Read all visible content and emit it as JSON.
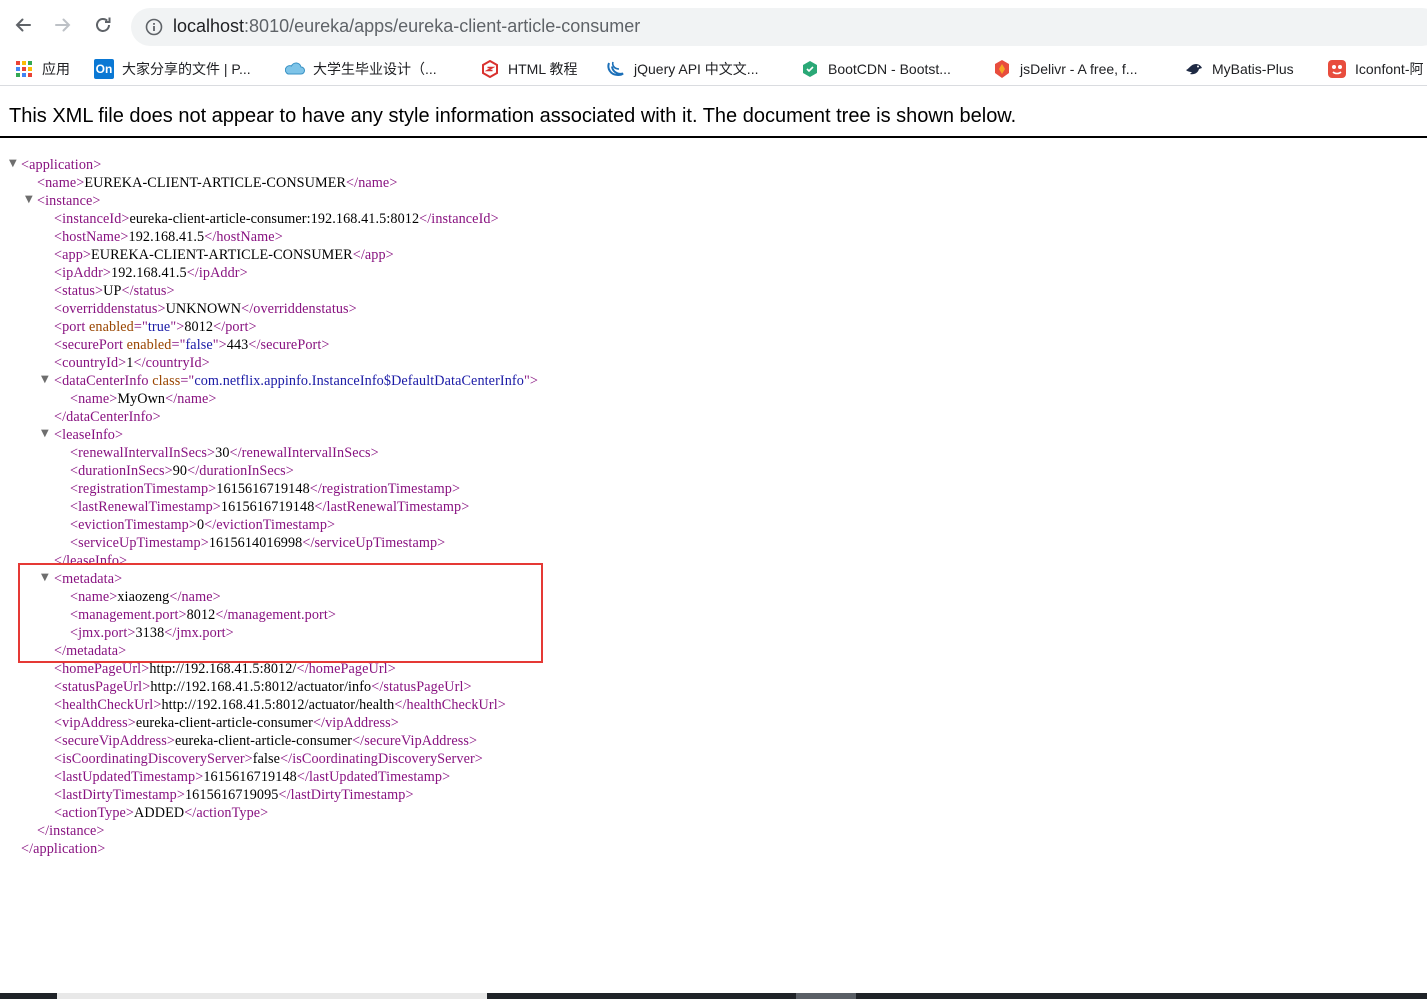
{
  "browser": {
    "url_host": "localhost",
    "url_path": ":8010/eureka/apps/eureka-client-article-consumer"
  },
  "bookmarks": [
    {
      "label": "应用",
      "icon": "apps-grid-icon"
    },
    {
      "label": "大家分享的文件 | P...",
      "icon": "onedrive-on-icon",
      "icon_text": "On"
    },
    {
      "label": "大学生毕业设计（...",
      "icon": "cloud-icon"
    },
    {
      "label": "HTML 教程",
      "icon": "runoob-icon"
    },
    {
      "label": "jQuery API 中文文...",
      "icon": "jquery-icon"
    },
    {
      "label": "BootCDN - Bootst...",
      "icon": "bootcdn-icon"
    },
    {
      "label": "jsDelivr - A free, f...",
      "icon": "jsdelivr-icon"
    },
    {
      "label": "MyBatis-Plus",
      "icon": "mybatis-bird-icon"
    },
    {
      "label": "Iconfont-阿",
      "icon": "iconfont-icon"
    }
  ],
  "page": {
    "notice": "This XML file does not appear to have any style information associated with it. The document tree is shown below."
  },
  "xml": {
    "application": "application",
    "name_tag": "name",
    "app_name": "EUREKA-CLIENT-ARTICLE-CONSUMER",
    "instance": "instance",
    "instanceId": "eureka-client-article-consumer:192.168.41.5:8012",
    "hostName": "192.168.41.5",
    "app": "EUREKA-CLIENT-ARTICLE-CONSUMER",
    "ipAddr": "192.168.41.5",
    "status": "UP",
    "overriddenstatus": "UNKNOWN",
    "port_enabled": "true",
    "port": "8012",
    "securePort_enabled": "false",
    "securePort": "443",
    "countryId": "1",
    "dataCenterInfo_class": "com.netflix.appinfo.InstanceInfo$DefaultDataCenterInfo",
    "dataCenterInfo_name": "MyOwn",
    "renewalIntervalInSecs": "30",
    "durationInSecs": "90",
    "registrationTimestamp": "1615616719148",
    "lastRenewalTimestamp": "1615616719148",
    "evictionTimestamp": "0",
    "serviceUpTimestamp": "1615614016998",
    "metadata_name": "xiaozeng",
    "management_port": "8012",
    "jmx_port": "3138",
    "homePageUrl": "http://192.168.41.5:8012/",
    "statusPageUrl": "http://192.168.41.5:8012/actuator/info",
    "healthCheckUrl": "http://192.168.41.5:8012/actuator/health",
    "vipAddress": "eureka-client-article-consumer",
    "secureVipAddress": "eureka-client-article-consumer",
    "isCoordinatingDiscoveryServer": "false",
    "lastUpdatedTimestamp": "1615616719148",
    "lastDirtyTimestamp": "1615616719095",
    "actionType": "ADDED"
  },
  "colors": {
    "tag": "#881280",
    "attr_name": "#994500",
    "attr_value": "#1a1aa6",
    "highlight": "#e53935"
  }
}
